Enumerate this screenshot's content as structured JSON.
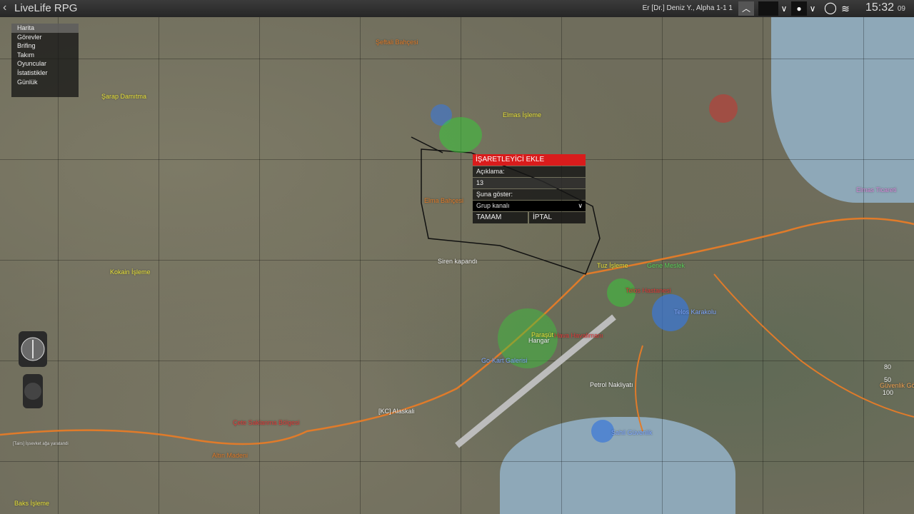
{
  "topbar": {
    "back_icon": "chevron-left-icon",
    "title": "LiveLife RPG",
    "player": "Er [Dr.] Deniz Y., Alpha 1-1 1",
    "clock": "15:32",
    "seconds": "09"
  },
  "menu": {
    "items": [
      "Harita",
      "Görevler",
      "Brifing",
      "Takım",
      "Oyuncular",
      "İstatistikler",
      "Günlük"
    ]
  },
  "dialog": {
    "title": "İŞARETLEYİCİ EKLE",
    "description_label": "Açıklama:",
    "description_value": "13",
    "show_label": "Şuna göster:",
    "channel_value": "Grup kanalı",
    "ok_label": "TAMAM",
    "cancel_label": "İPTAL"
  },
  "map_labels": {
    "serap": "Şarap Damıtma",
    "seftali": "Şeftali Bahçesi",
    "elmas_isleme": "Elmas İşleme",
    "elma_bahcesi": "Elma Bahçesi",
    "kokain": "Kokain İşleme",
    "siren": "Siren kapandı",
    "tuz": "Tuz İşleme",
    "gene_meslek": "Gene Meslek",
    "telos_hastanesi": "Telos Hastanesi",
    "telos_karakolu": "Telos Karakolu",
    "parasut": "Paraşüt",
    "havalimani": "Hava Havalimanı",
    "hangar": "Hangar",
    "gokart": "Go-Kart Galerisi",
    "petrol": "Petrol Nakliyatı",
    "sahil": "Sahil Güvenlik",
    "kc": "[KC] Alaskali",
    "cete": "Çete Saklanma Bölgesi",
    "altin": "Altın Madeni",
    "baks": "Baks İşleme",
    "elmas_ticareti": "Elmas Ticareti",
    "tairs": "[Tairs] İşsevket ağa yaratandi",
    "guvenlik_gorevlisi": "Güvenlik Görevlisi",
    "sp80": "80",
    "sp50": "50",
    "sp100": "100"
  },
  "colors": {
    "accent_red": "#d91c1c",
    "label_yellow": "#e8e23a",
    "label_orange": "#e07b2a",
    "zone_blue": "#3a78d8",
    "zone_green": "#3ac83a"
  }
}
